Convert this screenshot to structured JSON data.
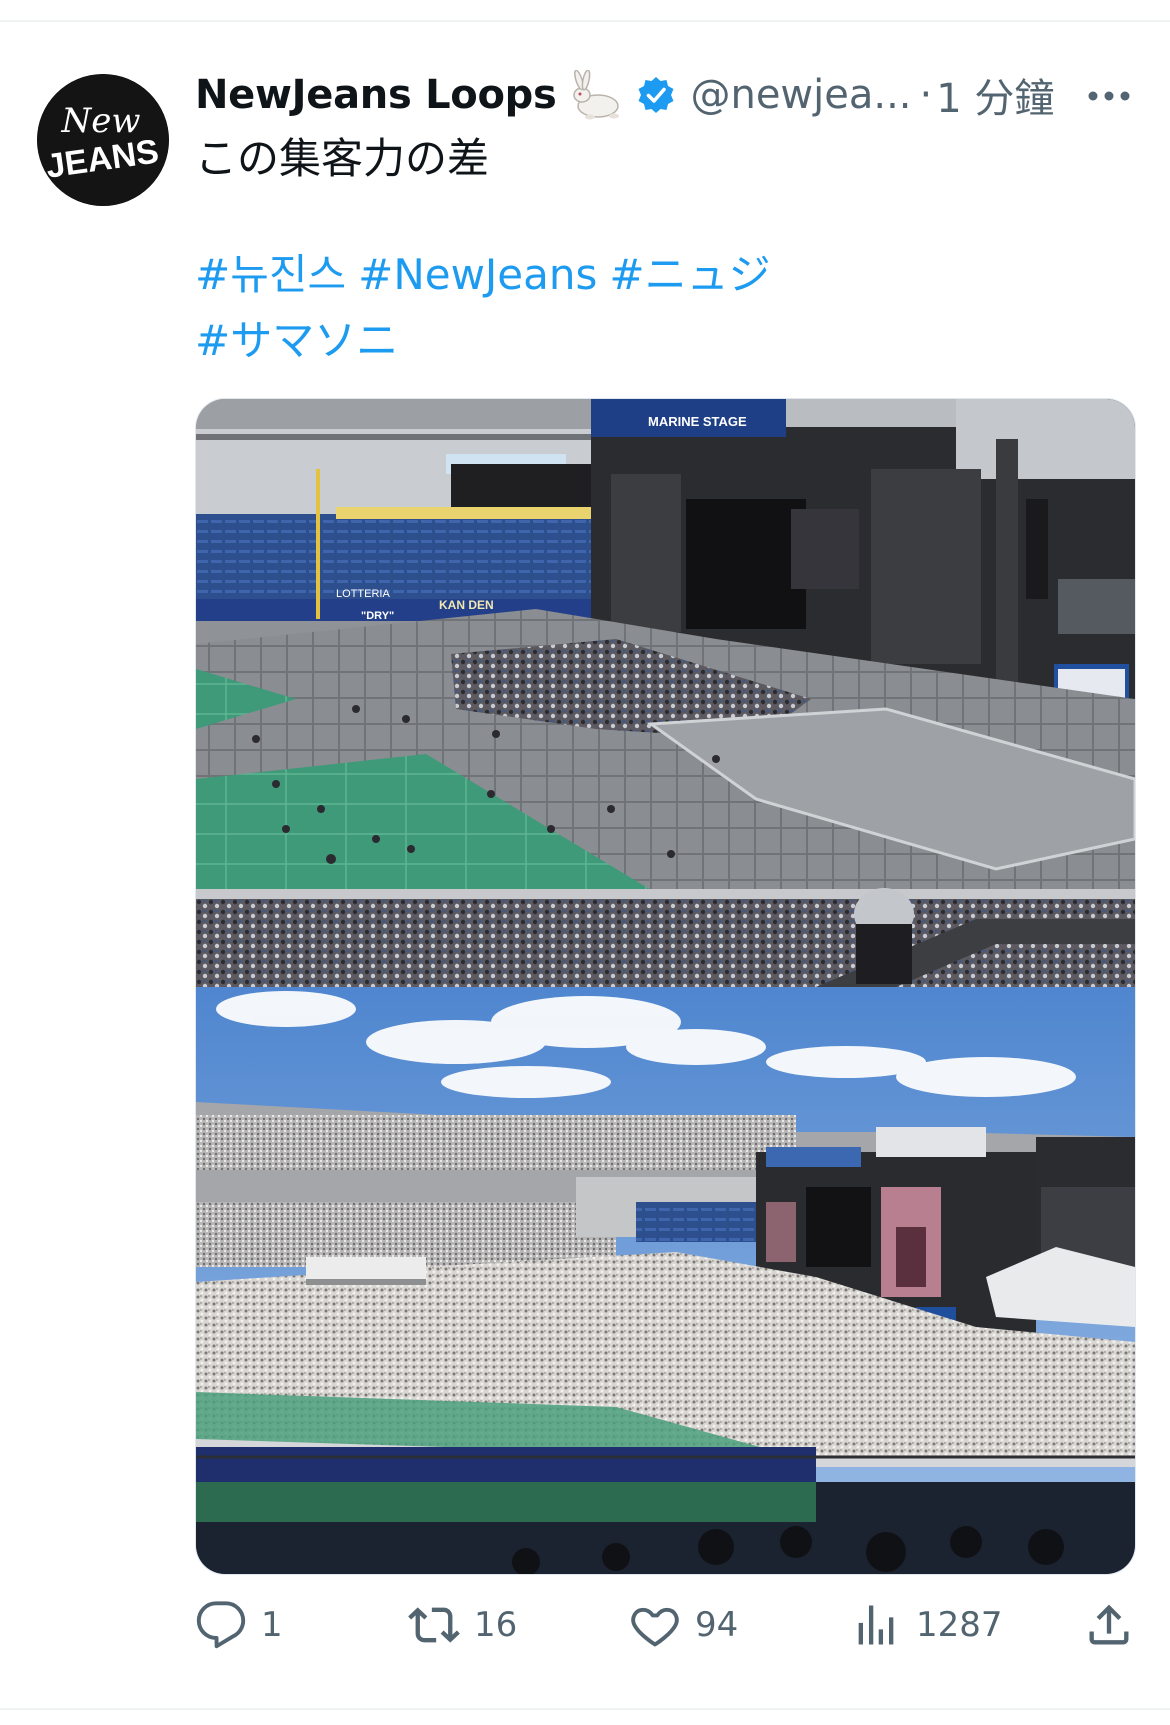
{
  "tweet": {
    "author_name": "NewJeans Loops",
    "author_emoji": "rabbit-emoji",
    "handle": "@newjea...",
    "separator": "·",
    "time": "1 分鐘",
    "text": "この集客力の差",
    "hashtags": [
      "#뉴진스",
      "#NewJeans",
      "#ニュジ",
      "#サマソニ"
    ],
    "avatar_text": [
      "New",
      "JEANS"
    ],
    "media_signage": {
      "top_stage": "MARINE STAGE",
      "top_ad_1": "KAN DEN",
      "top_ad_2": "\"DRY\"",
      "top_ad_3": "LOTTERIA"
    }
  },
  "actions": {
    "replies": "1",
    "retweets": "16",
    "likes": "94",
    "views": "1287"
  },
  "colors": {
    "link": "#1d9bf0",
    "muted": "#536471",
    "verified": "#1d9bf0"
  }
}
